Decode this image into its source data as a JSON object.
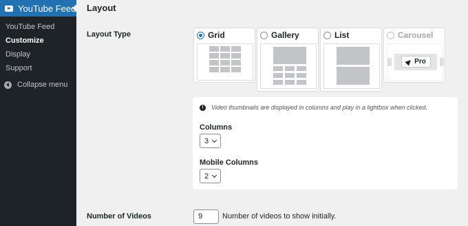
{
  "sidebar": {
    "menu_title": "YouTube Feed",
    "items": [
      {
        "label": "YouTube Feed"
      },
      {
        "label": "Customize"
      },
      {
        "label": "Display"
      },
      {
        "label": "Support"
      }
    ],
    "collapse_label": "Collapse menu"
  },
  "main": {
    "title": "Layout",
    "layout_type_label": "Layout Type",
    "layouts": [
      {
        "name": "Grid",
        "selected": true
      },
      {
        "name": "Gallery",
        "selected": false
      },
      {
        "name": "List",
        "selected": false
      },
      {
        "name": "Carousel",
        "selected": false,
        "badge": "Pro"
      }
    ],
    "info_text": "Video thumbnails are displayed in columns and play in a lightbox when clicked.",
    "info_icon": "!",
    "columns_label": "Columns",
    "columns_value": "3",
    "mobile_columns_label": "Mobile Columns",
    "mobile_columns_value": "2",
    "num_videos_label": "Number of Videos",
    "num_videos_value": "9",
    "num_videos_help": "Number of videos to show initially."
  },
  "colors": {
    "accent": "#2271b1",
    "sidebar_bg": "#1d2327",
    "page_bg": "#f0f0f1"
  }
}
